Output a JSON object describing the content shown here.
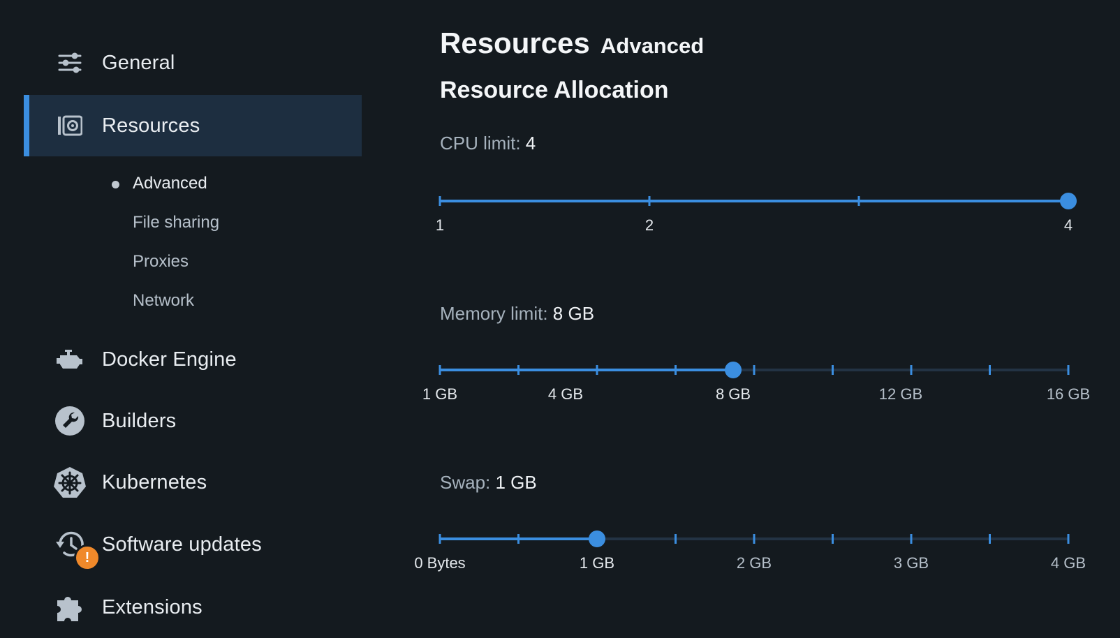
{
  "sidebar": {
    "items": [
      {
        "label": "General",
        "icon": "sliders-icon"
      },
      {
        "label": "Resources",
        "icon": "disk-icon",
        "active": true
      },
      {
        "label": "Docker Engine",
        "icon": "engine-icon"
      },
      {
        "label": "Builders",
        "icon": "wrench-icon"
      },
      {
        "label": "Kubernetes",
        "icon": "helm-icon"
      },
      {
        "label": "Software updates",
        "icon": "history-icon",
        "badge": "!"
      },
      {
        "label": "Extensions",
        "icon": "puzzle-icon"
      }
    ],
    "sub_items": [
      {
        "label": "Advanced",
        "current": true
      },
      {
        "label": "File sharing"
      },
      {
        "label": "Proxies"
      },
      {
        "label": "Network"
      }
    ]
  },
  "main": {
    "title": "Resources",
    "tab": "Advanced",
    "section_title": "Resource Allocation",
    "cpu": {
      "label": "CPU limit:",
      "value": "4",
      "labels": [
        {
          "text": "1",
          "pos": 0
        },
        {
          "text": "2",
          "pos": 0.3333
        },
        {
          "text": "4",
          "pos": 1
        }
      ]
    },
    "memory": {
      "label": "Memory limit:",
      "value": "8 GB",
      "labels": [
        {
          "text": "1 GB",
          "pos": 0
        },
        {
          "text": "4 GB",
          "pos": 0.2
        },
        {
          "text": "8 GB",
          "pos": 0.4667
        },
        {
          "text": "12 GB",
          "pos": 0.7333
        },
        {
          "text": "16 GB",
          "pos": 1
        }
      ]
    },
    "swap": {
      "label": "Swap:",
      "value": "1 GB",
      "labels": [
        {
          "text": "0 Bytes",
          "pos": 0
        },
        {
          "text": "1 GB",
          "pos": 0.25
        },
        {
          "text": "2 GB",
          "pos": 0.5
        },
        {
          "text": "3 GB",
          "pos": 0.75
        },
        {
          "text": "4 GB",
          "pos": 1
        }
      ]
    }
  },
  "colors": {
    "accent": "#3b8ee0",
    "track": "#233344",
    "badge": "#f0892a"
  }
}
